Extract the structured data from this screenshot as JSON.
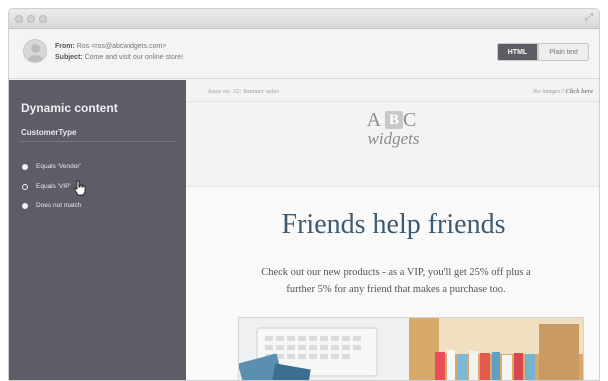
{
  "header": {
    "from_label": "From:",
    "from_value": "Ros <ros@abcwidgets.com>",
    "subject_label": "Subject:",
    "subject_value": "Come and visit our online store!",
    "view_html": "HTML",
    "view_plain": "Plain text"
  },
  "sidebar": {
    "title": "Dynamic content",
    "field": "CustomerType",
    "options": [
      {
        "label": "Equals 'Vendor'",
        "selected": true
      },
      {
        "label": "Equals 'VIP'",
        "selected": false
      },
      {
        "label": "Does not match",
        "selected": true
      }
    ]
  },
  "email": {
    "issue": "Issue no. 32: Summer sales",
    "no_images_prefix": "No images?",
    "no_images_link": "Click here",
    "logo_top": "A",
    "logo_mid": "B",
    "logo_end": "C",
    "logo_bottom": "widgets",
    "headline": "Friends help friends",
    "body": "Check out our new products - as a VIP, you'll get 25% off plus a further 5% for any friend that makes a purchase too."
  },
  "icons": [
    "window-control-icon",
    "resize-icon",
    "avatar-icon",
    "radio-icon",
    "hand-cursor-icon"
  ]
}
